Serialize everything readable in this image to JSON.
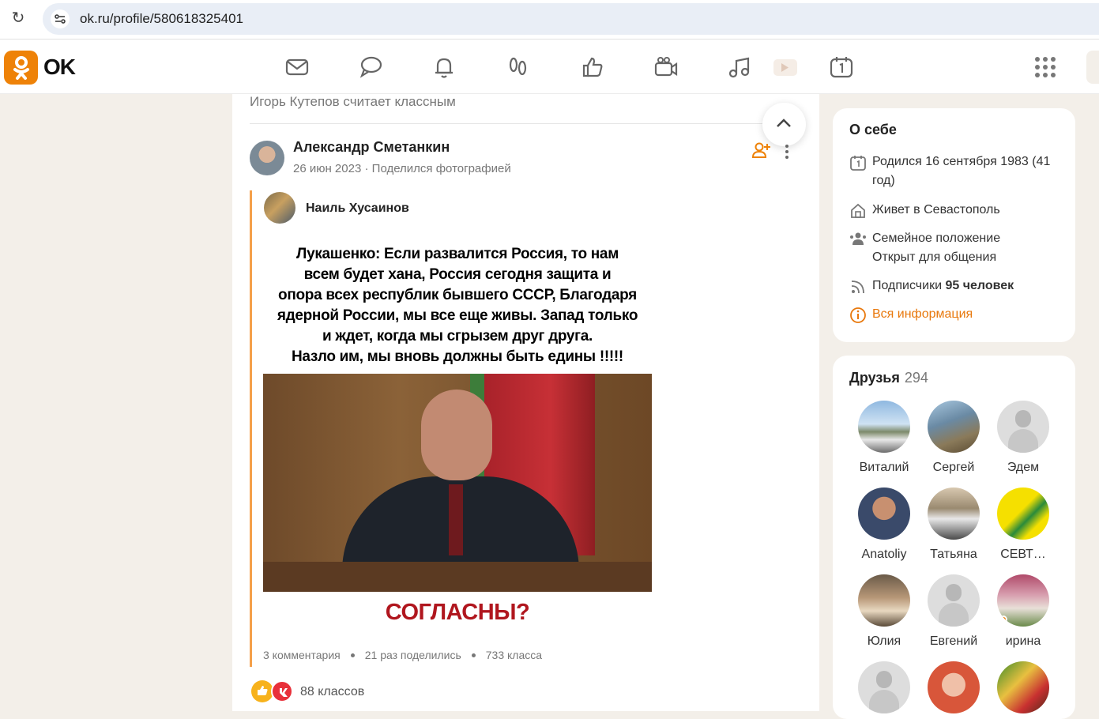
{
  "browser": {
    "url": "ok.ru/profile/580618325401"
  },
  "header": {
    "logo_text": "OK",
    "nav_icons": [
      "messages-icon",
      "discussions-icon",
      "notifications-icon",
      "guests-icon",
      "likes-icon",
      "video-calls-icon",
      "music-icon",
      "video-icon",
      "calendar-icon",
      "apps-grid-icon"
    ],
    "accent_color": "#ee8208"
  },
  "feed": {
    "liked_by": "Игорь Кутепов считает классным",
    "post": {
      "author": "Александр Сметанкин",
      "date": "26 июн 2023",
      "action": "Поделился фотографией",
      "original_author": "Наиль Хусаинов",
      "meme_lines": [
        "Лукашенко: Если развалится Россия, то нам",
        "всем будет хана, Россия сегодня защита и",
        "опора всех республик бывшего СССР, Благодаря",
        "ядерной России, мы все еще живы. Запад только",
        "и ждет, когда мы сгрызем друг друга.",
        "Назло им, мы вновь должны быть едины !!!!!"
      ],
      "meme_bottom": "СОГЛАСНЫ?",
      "comments": "3 комментария",
      "shares": "21 раз поделились",
      "classes": "733 класса",
      "reactions_count": "88 классов"
    }
  },
  "about": {
    "title": "О себе",
    "birth": "Родился 16 сентября 1983 (41 год)",
    "lives": "Живет в Севастополь",
    "status_label": "Семейное положение",
    "status_value": "Открыт для общения",
    "subscribers_label": "Подписчики",
    "subscribers_value": "95 человек",
    "all_info": "Вся информация"
  },
  "friends": {
    "title": "Друзья",
    "count": "294",
    "items": [
      {
        "name": "Виталий"
      },
      {
        "name": "Сергей"
      },
      {
        "name": "Эдем"
      },
      {
        "name": "Anatoliy"
      },
      {
        "name": "Татьяна"
      },
      {
        "name": "СЕВТ…"
      },
      {
        "name": "Юлия"
      },
      {
        "name": "Евгений"
      },
      {
        "name": "ирина"
      }
    ]
  }
}
